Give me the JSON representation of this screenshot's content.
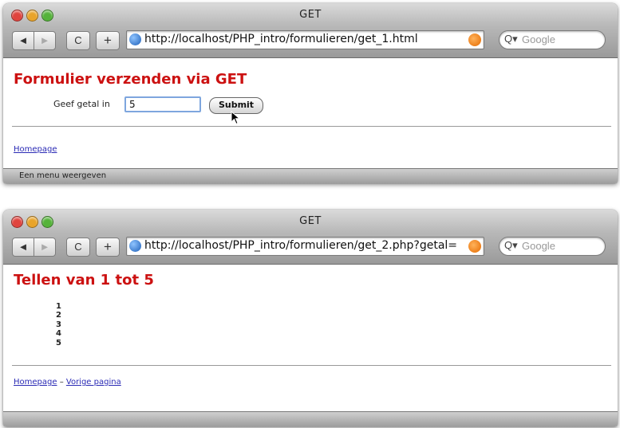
{
  "window1": {
    "title": "GET",
    "toolbar": {
      "back": "◄",
      "forward": "►",
      "reload": "C",
      "add": "+",
      "url": "http://localhost/PHP_intro/formulieren/get_1.html",
      "search_placeholder": "Google",
      "search_icon_glyph": "Q▾"
    },
    "page": {
      "heading": "Formulier verzenden via GET",
      "field_label": "Geef getal in",
      "field_value": "5",
      "submit_label": "Submit",
      "link_homepage": "Homepage"
    },
    "status_text": "Een menu weergeven"
  },
  "window2": {
    "title": "GET",
    "toolbar": {
      "back": "◄",
      "forward": "►",
      "reload": "C",
      "add": "+",
      "url": "http://localhost/PHP_intro/formulieren/get_2.php?getal=",
      "search_placeholder": "Google",
      "search_icon_glyph": "Q▾"
    },
    "page": {
      "heading": "Tellen van 1 tot 5",
      "numbers": [
        "1",
        "2",
        "3",
        "4",
        "5"
      ],
      "link_homepage": "Homepage",
      "separator": "–",
      "link_previous": "Vorige pagina"
    }
  },
  "colors": {
    "heading": "#cc1111",
    "link": "#2b2bb5",
    "focus_ring": "#7ea6de"
  }
}
